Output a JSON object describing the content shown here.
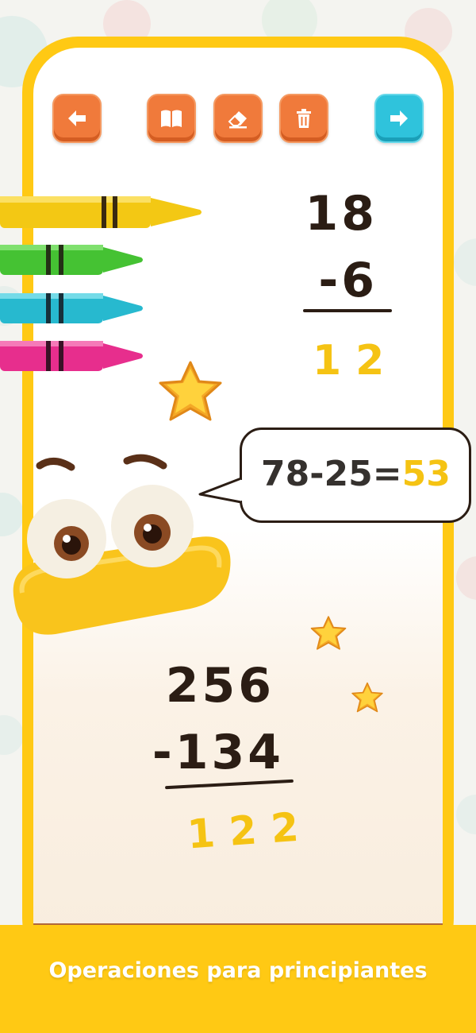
{
  "toolbar": {
    "back_icon": "arrow-left-icon",
    "book_icon": "book-icon",
    "eraser_icon": "eraser-icon",
    "trash_icon": "trash-icon",
    "next_icon": "arrow-right-icon"
  },
  "problem1": {
    "top": "18",
    "bottom": "-6",
    "answer": "12"
  },
  "bubble": {
    "equation": "78-25=",
    "result": "53"
  },
  "problem2": {
    "top": "256",
    "bottom": "-134",
    "answer": "122"
  },
  "banner": {
    "text": "Operaciones para principiantes"
  },
  "colors": {
    "frame_yellow": "#ffc914",
    "button_orange": "#f07a3b",
    "button_teal": "#2fc3dc",
    "answer_yellow": "#f5c313",
    "ink": "#2b1d14",
    "floor_brown": "#b0683a"
  }
}
